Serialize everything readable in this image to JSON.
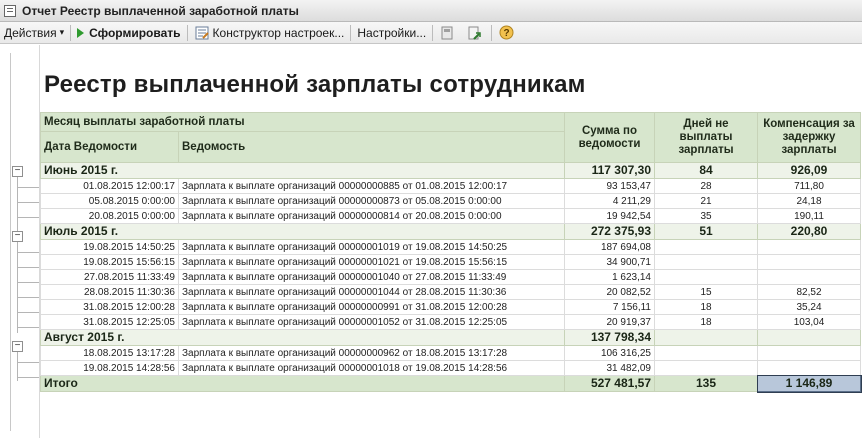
{
  "window": {
    "title": "Отчет  Реестр выплаченной заработной платы"
  },
  "toolbar": {
    "actions_label": "Действия",
    "generate_label": "Сформировать",
    "constructor_label": "Конструктор настроек...",
    "settings_label": "Настройки..."
  },
  "report": {
    "title": "Реестр выплаченной зарплаты сотрудникам",
    "headers": {
      "month": "Месяц выплаты заработной платы",
      "date": "Дата Ведомости",
      "statement": "Ведомость",
      "sum": "Сумма по ведомости",
      "days": "Дней не выплаты зарплаты",
      "comp": "Компенсация за задержку зарплаты"
    },
    "groups": [
      {
        "month": "Июнь 2015 г.",
        "sum": "117 307,30",
        "days": "84",
        "comp": "926,09",
        "rows": [
          {
            "date": "01.08.2015 12:00:17",
            "doc": "Зарплата к выплате организаций 00000000885 от 01.08.2015 12:00:17",
            "sum": "93 153,47",
            "days": "28",
            "comp": "711,80"
          },
          {
            "date": "05.08.2015 0:00:00",
            "doc": "Зарплата к выплате организаций 00000000873 от 05.08.2015 0:00:00",
            "sum": "4 211,29",
            "days": "21",
            "comp": "24,18"
          },
          {
            "date": "20.08.2015 0:00:00",
            "doc": "Зарплата к выплате организаций 00000000814 от 20.08.2015 0:00:00",
            "sum": "19 942,54",
            "days": "35",
            "comp": "190,11"
          }
        ]
      },
      {
        "month": "Июль 2015 г.",
        "sum": "272 375,93",
        "days": "51",
        "comp": "220,80",
        "rows": [
          {
            "date": "19.08.2015 14:50:25",
            "doc": "Зарплата к выплате организаций 00000001019 от 19.08.2015 14:50:25",
            "sum": "187 694,08",
            "days": "",
            "comp": ""
          },
          {
            "date": "19.08.2015 15:56:15",
            "doc": "Зарплата к выплате организаций 00000001021 от 19.08.2015 15:56:15",
            "sum": "34 900,71",
            "days": "",
            "comp": ""
          },
          {
            "date": "27.08.2015 11:33:49",
            "doc": "Зарплата к выплате организаций 00000001040 от 27.08.2015 11:33:49",
            "sum": "1 623,14",
            "days": "",
            "comp": ""
          },
          {
            "date": "28.08.2015 11:30:36",
            "doc": "Зарплата к выплате организаций 00000001044 от 28.08.2015 11:30:36",
            "sum": "20 082,52",
            "days": "15",
            "comp": "82,52"
          },
          {
            "date": "31.08.2015 12:00:28",
            "doc": "Зарплата к выплате организаций 00000000991 от 31.08.2015 12:00:28",
            "sum": "7 156,11",
            "days": "18",
            "comp": "35,24"
          },
          {
            "date": "31.08.2015 12:25:05",
            "doc": "Зарплата к выплате организаций 00000001052 от 31.08.2015 12:25:05",
            "sum": "20 919,37",
            "days": "18",
            "comp": "103,04"
          }
        ]
      },
      {
        "month": "Август 2015 г.",
        "sum": "137 798,34",
        "days": "",
        "comp": "",
        "rows": [
          {
            "date": "18.08.2015 13:17:28",
            "doc": "Зарплата к выплате организаций 00000000962 от 18.08.2015 13:17:28",
            "sum": "106 316,25",
            "days": "",
            "comp": ""
          },
          {
            "date": "19.08.2015 14:28:56",
            "doc": "Зарплата к выплате организаций 00000001018 от 19.08.2015 14:28:56",
            "sum": "31 482,09",
            "days": "",
            "comp": ""
          }
        ]
      }
    ],
    "total": {
      "label": "Итого",
      "sum": "527 481,57",
      "days": "135",
      "comp": "1 146,89"
    }
  },
  "colors": {
    "header_bg": "#d7e6cd",
    "group_bg": "#eef3e9",
    "selected_cell": "#b8c7da",
    "generate_icon": "#2f9a2f"
  },
  "icons": [
    "window-icon",
    "dropdown-caret-icon",
    "play-icon",
    "constructor-icon",
    "save-settings-icon",
    "load-settings-icon",
    "help-icon",
    "collapse-icon"
  ]
}
